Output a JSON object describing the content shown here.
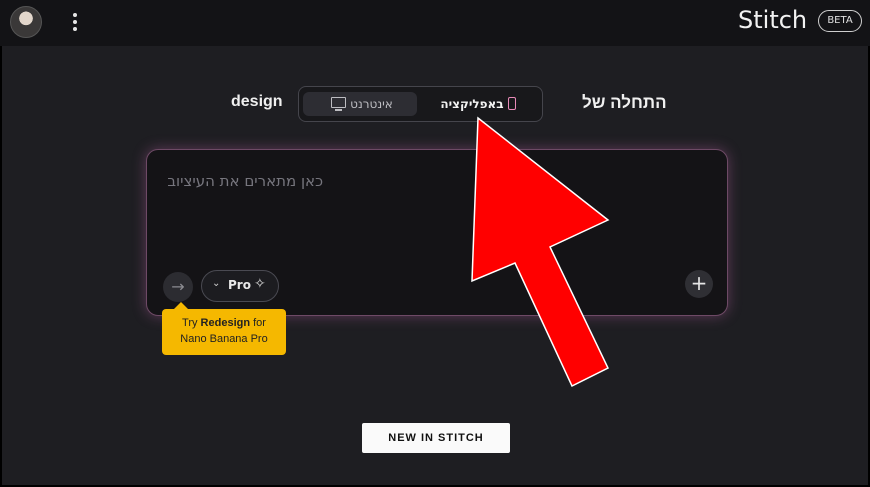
{
  "header": {
    "brand": "Stitch",
    "badge": "BETA"
  },
  "selector": {
    "start_label": "התחלה של",
    "design_label": "design",
    "options": [
      {
        "label": "אינטרנט",
        "icon": "monitor-icon",
        "selected": false
      },
      {
        "label": "באפליקציה",
        "icon": "mobile-phone-icon",
        "selected": true
      }
    ]
  },
  "prompt": {
    "placeholder": "כאן מתארים את העיציוב",
    "model": "Pro",
    "submit_icon": "arrow-right-icon",
    "add_icon": "plus-icon"
  },
  "tooltip": {
    "prefix": "Try ",
    "bold": "Redesign",
    "suffix": " for",
    "line2": "Nano Banana Pro"
  },
  "cta": {
    "label": "NEW IN STITCH"
  },
  "colors": {
    "accent_glow": "#d670be",
    "tooltip_bg": "#f5b800",
    "annotation_arrow": "#ff0000"
  }
}
